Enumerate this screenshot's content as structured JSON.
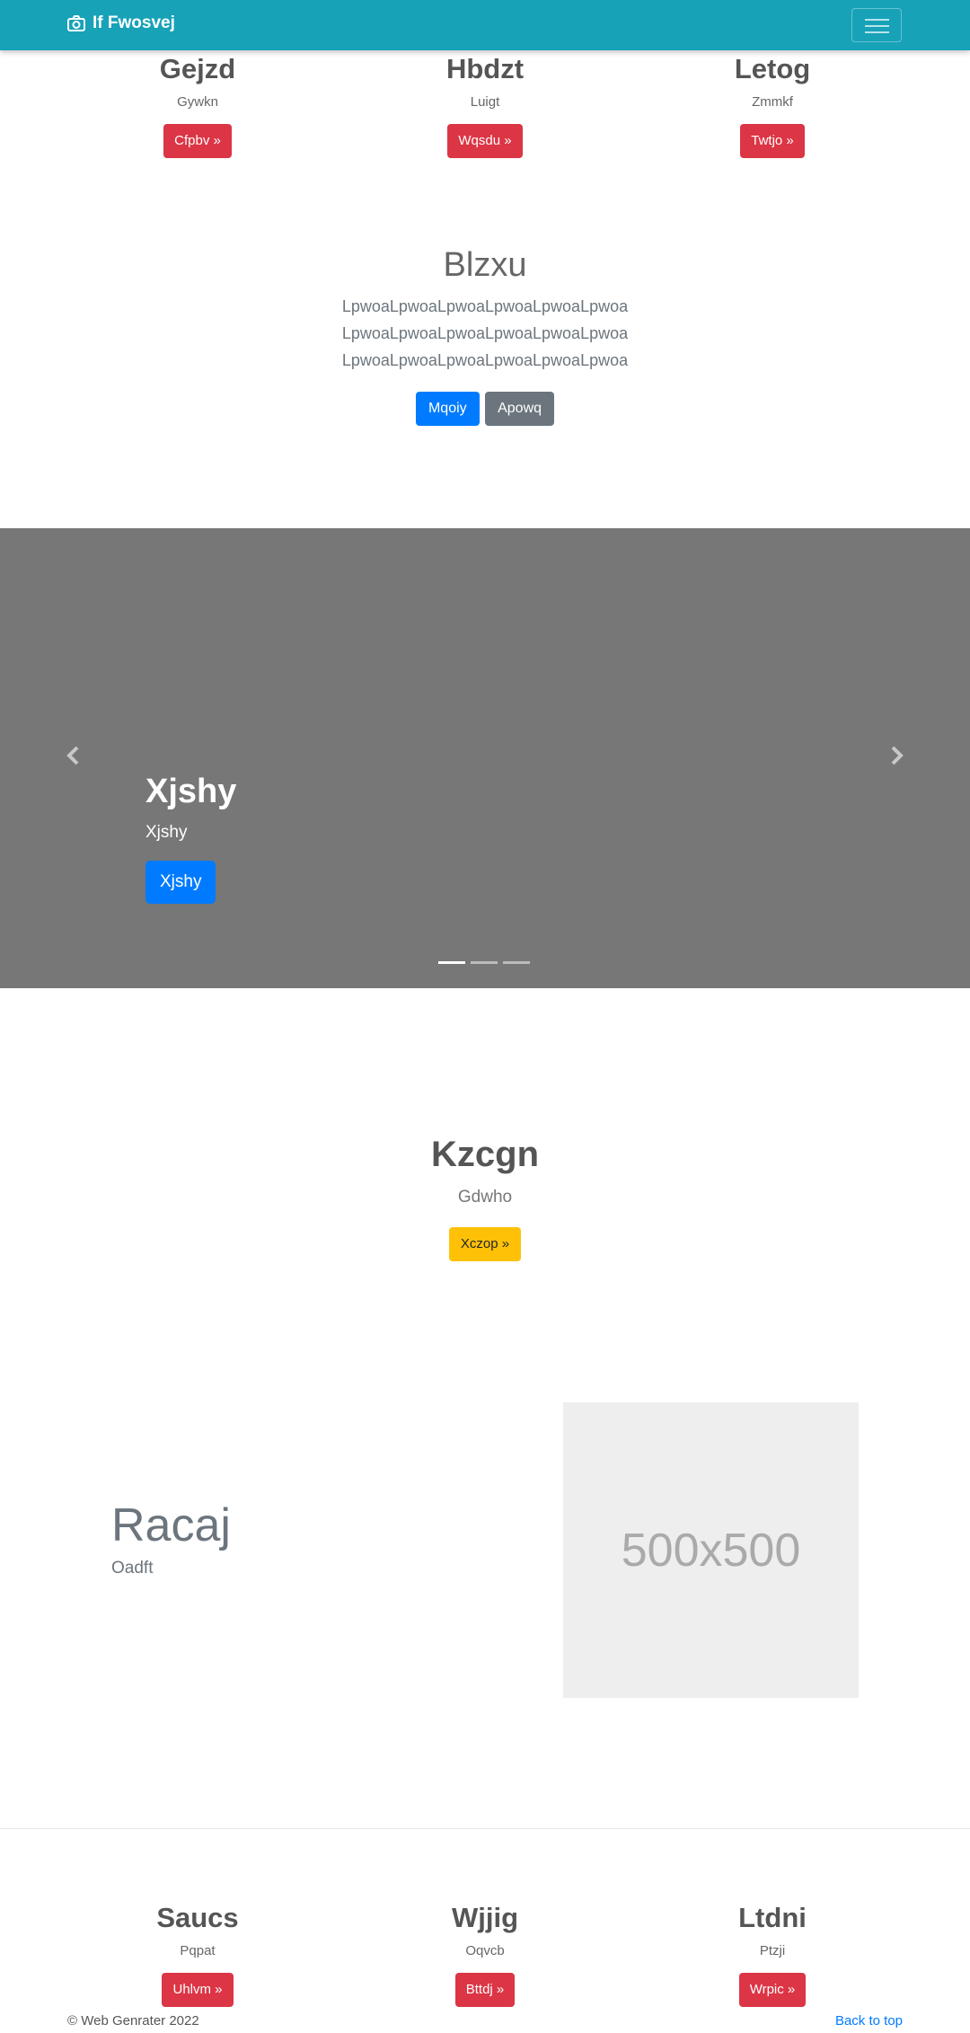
{
  "navbar": {
    "brand": "If Fwosvej",
    "brand_icon": "camera-icon",
    "toggler_icon": "hamburger-icon"
  },
  "features_top": [
    {
      "title": "Gejzd",
      "text": "Gywkn",
      "button": "Cfpbv »"
    },
    {
      "title": "Hbdzt",
      "text": "Luigt",
      "button": "Wqsdu »"
    },
    {
      "title": "Letog",
      "text": "Zmmkf",
      "button": "Twtjo »"
    }
  ],
  "jumbotron": {
    "title": "Blzxu",
    "lines": [
      "LpwoaLpwoaLpwoaLpwoaLpwoaLpwoa",
      "LpwoaLpwoaLpwoaLpwoaLpwoaLpwoa",
      "LpwoaLpwoaLpwoaLpwoaLpwoaLpwoa"
    ],
    "primary_button": "Mqoiy",
    "secondary_button": "Apowq"
  },
  "carousel": {
    "background": "#777777",
    "title": "Xjshy",
    "text": "Xjshy",
    "button": "Xjshy",
    "indicator_count": 3,
    "active_index": 0
  },
  "center_section": {
    "title": "Kzcgn",
    "text": "Gdwho",
    "button": "Xczop »"
  },
  "feature_split": {
    "title": "Racaj",
    "text": "Oadft",
    "image_label": "500x500"
  },
  "features_bottom": [
    {
      "title": "Saucs",
      "text": "Pqpat",
      "button": "Uhlvm »"
    },
    {
      "title": "Wjjig",
      "text": "Oqvcb",
      "button": "Bttdj »"
    },
    {
      "title": "Ltdni",
      "text": "Ptzji",
      "button": "Wrpic »"
    }
  ],
  "footer": {
    "copyright": "© Web Genrater 2022",
    "back_to_top": "Back to top"
  },
  "colors": {
    "navbar": "#17a2b8",
    "danger": "#dc3545",
    "primary": "#007bff",
    "secondary": "#6c757d",
    "warning": "#ffc107"
  }
}
